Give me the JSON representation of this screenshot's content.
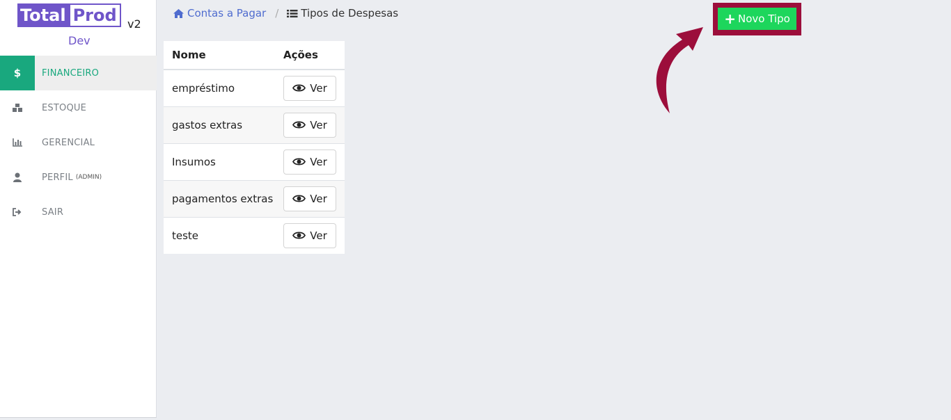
{
  "logo": {
    "part1": "Total",
    "part2": "Prod",
    "version": "v2",
    "env": "Dev"
  },
  "sidebar": {
    "items": [
      {
        "label": "FINANCEIRO",
        "icon": "dollar-icon",
        "glyph": "$",
        "active": true
      },
      {
        "label": "ESTOQUE",
        "icon": "boxes-icon",
        "active": false
      },
      {
        "label": "GERENCIAL",
        "icon": "bar-chart-icon",
        "active": false
      },
      {
        "label": "PERFIL",
        "sub": "(ADMIN)",
        "icon": "user-icon",
        "active": false
      },
      {
        "label": "SAIR",
        "icon": "sign-out-icon",
        "active": false
      }
    ]
  },
  "breadcrumb": {
    "home_label": "Contas a Pagar",
    "current_label": "Tipos de Despesas"
  },
  "toolbar": {
    "new_button_label": "Novo Tipo"
  },
  "table": {
    "headers": [
      "Nome",
      "Ações"
    ],
    "rows": [
      {
        "name": "empréstimo",
        "action": "Ver"
      },
      {
        "name": "gastos extras",
        "action": "Ver"
      },
      {
        "name": "Insumos",
        "action": "Ver"
      },
      {
        "name": "pagamentos extras",
        "action": "Ver"
      },
      {
        "name": "teste",
        "action": "Ver"
      }
    ]
  },
  "colors": {
    "brand": "#6f55c9",
    "active_nav": "#19a87e",
    "new_button": "#1dd65c",
    "highlight": "#9c0e3b",
    "link": "#4f6ccf"
  }
}
